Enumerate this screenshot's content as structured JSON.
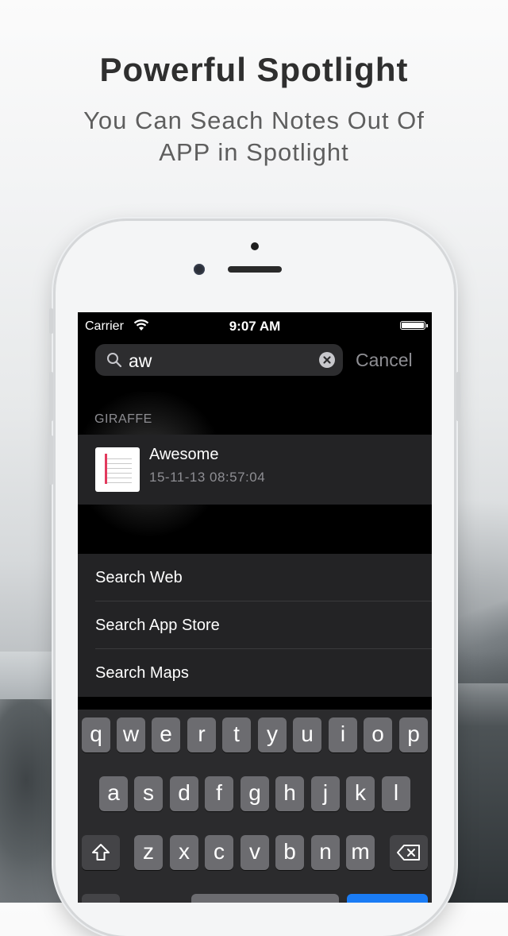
{
  "header": {
    "title": "Powerful Spotlight",
    "subtitle": "You Can Seach Notes Out Of APP in Spotlight"
  },
  "status_bar": {
    "carrier": "Carrier",
    "time": "9:07 AM"
  },
  "search": {
    "query": "aw",
    "cancel_label": "Cancel"
  },
  "results": {
    "section_label": "GIRAFFE",
    "items": [
      {
        "title": "Awesome",
        "date": "15-11-13 08:57:04"
      }
    ]
  },
  "search_options": [
    {
      "label": "Search Web"
    },
    {
      "label": "Search App Store"
    },
    {
      "label": "Search Maps"
    }
  ],
  "keyboard": {
    "row1": [
      "q",
      "w",
      "e",
      "r",
      "t",
      "y",
      "u",
      "i",
      "o",
      "p"
    ],
    "row2": [
      "a",
      "s",
      "d",
      "f",
      "g",
      "h",
      "j",
      "k",
      "l"
    ],
    "row3": [
      "z",
      "x",
      "c",
      "v",
      "b",
      "n",
      "m"
    ]
  },
  "colors": {
    "accent_red": "#e23a5d",
    "key_bg": "#6c6c70",
    "screen_bg": "#000000"
  }
}
